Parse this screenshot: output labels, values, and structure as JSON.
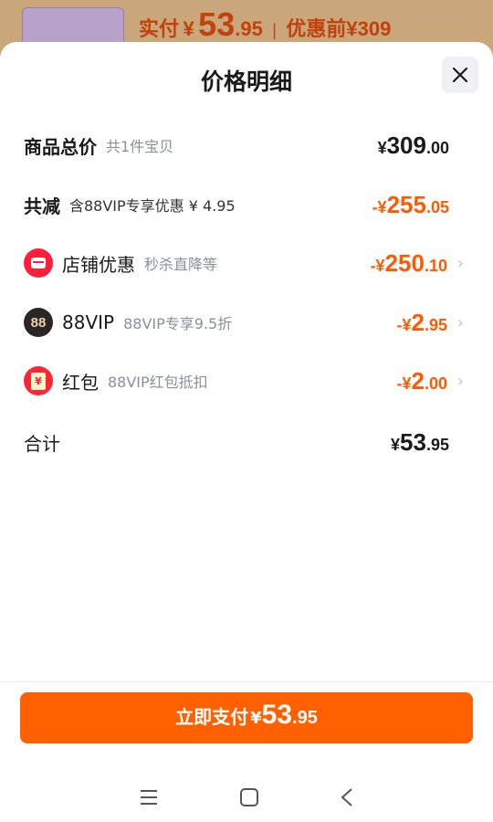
{
  "background": {
    "price_label": "实付",
    "currency": "¥",
    "price_int": "53",
    "price_dec": ".95",
    "original_label": "优惠前",
    "original_price": "¥309"
  },
  "sheet": {
    "title": "价格明细"
  },
  "rows": {
    "total": {
      "label": "商品总价",
      "sub": "共1件宝贝",
      "cur": "¥",
      "int": "309",
      "dec": ".00"
    },
    "reduce": {
      "label": "共减",
      "sub": "含88VIP专享优惠 ¥ 4.95",
      "cur": "-¥",
      "int": "255",
      "dec": ".05"
    },
    "shop": {
      "label": "店铺优惠",
      "sub": "秒杀直降等",
      "cur": "-¥",
      "int": "250",
      "dec": ".10"
    },
    "vip": {
      "icon_text": "88",
      "label": "88VIP",
      "sub": "88VIP专享9.5折",
      "cur": "-¥",
      "int": "2",
      "dec": ".95"
    },
    "hongbao": {
      "icon_text": "¥",
      "label": "红包",
      "sub": "88VIP红包抵扣",
      "cur": "-¥",
      "int": "2",
      "dec": ".00"
    },
    "sum": {
      "label": "合计",
      "cur": "¥",
      "int": "53",
      "dec": ".95"
    }
  },
  "pay_button": {
    "label": "立即支付",
    "cur": "¥",
    "int": "53",
    "dec": ".95"
  },
  "colors": {
    "accent": "#ff6000",
    "discount": "#ff5a00"
  }
}
